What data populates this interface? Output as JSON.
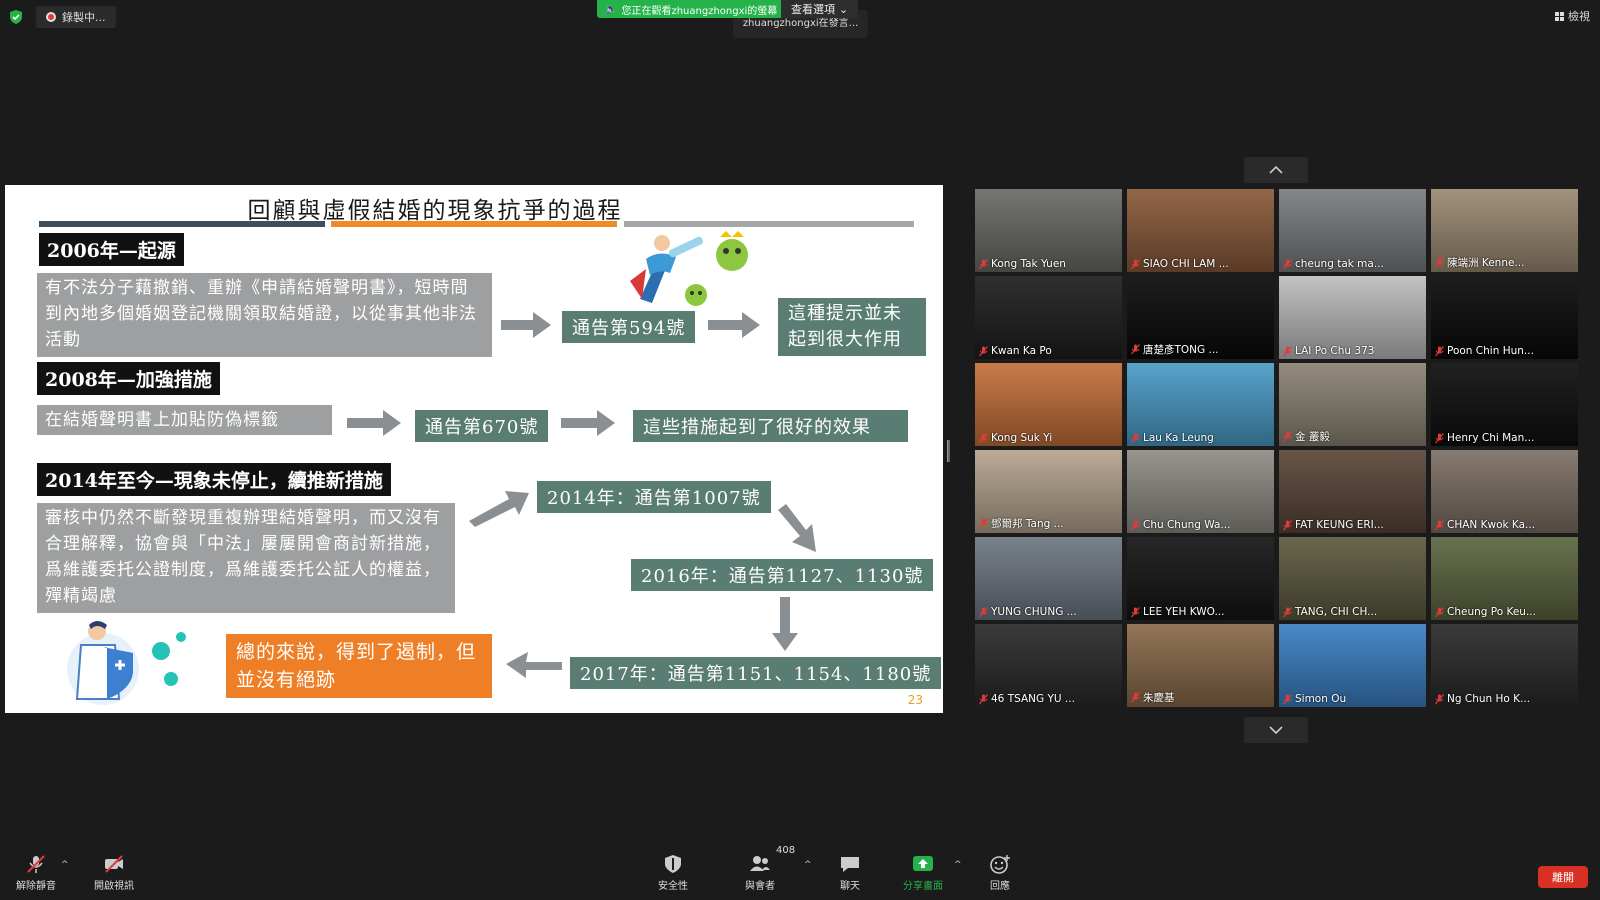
{
  "top": {
    "recording_label": "錄製中...",
    "viewing_banner": "您正在觀看zhuangzhongxi的螢幕",
    "view_options_label": "查看選項",
    "sharer_tip": "zhuangzhongxi在發言...",
    "view_label": "檢視"
  },
  "slide": {
    "title": "回顧與虛假結婚的現象抗爭的過程",
    "page_number": "23",
    "sec1": {
      "header": "2006年—起源",
      "text": "有不法分子藉撤銷、重辦《申請結婚聲明書》，短時間到內地多個婚姻登記機關領取結婚證，以從事其他非法活動",
      "notice": "通告第594號",
      "result": "這種提示並未起到很大作用"
    },
    "sec2": {
      "header": "2008年—加強措施",
      "text": "在結婚聲明書上加貼防偽標籤",
      "notice": "通告第670號",
      "result": "這些措施起到了很好的效果"
    },
    "sec3": {
      "header": "2014年至今—現象未停止，續推新措施",
      "text": "審核中仍然不斷發現重複辦理結婚聲明，而又沒有合理解釋，協會與「中法」屢屢開會商討新措施，爲維護委托公證制度，爲維護委托公証人的權益，殫精竭慮",
      "n2014": "2014年：通告第1007號",
      "n2016": "2016年：通告第1127、1130號",
      "n2017": "2017年：通告第1151、1154、1180號",
      "conclusion": "總的來說，得到了遏制，但並沒有絕跡"
    }
  },
  "participants": [
    {
      "name": "Kong Tak Yuen",
      "bg": "#6b6a66"
    },
    {
      "name": "SIAO CHI LAM ...",
      "bg": "#8a5a3a"
    },
    {
      "name": "cheung tak ma...",
      "bg": "#7a7c7e"
    },
    {
      "name": "陳端洲 Kenne...",
      "bg": "#9b8a72"
    },
    {
      "name": "Kwan Ka Po",
      "bg": "#1e1e1e"
    },
    {
      "name": "唐楚彥TONG ...",
      "bg": "#0a0a0a"
    },
    {
      "name": "LAI Po Chu 373",
      "bg": "#bdbdbd"
    },
    {
      "name": "Poon Chin Hun...",
      "bg": "#0a0a0a"
    },
    {
      "name": "Kong Suk Yi",
      "bg": "#c4703a"
    },
    {
      "name": "Lau Ka Leung",
      "bg": "#4a9cc8"
    },
    {
      "name": "金 叢毅",
      "bg": "#8b8373"
    },
    {
      "name": "Henry Chi Man...",
      "bg": "#0e0e0e"
    },
    {
      "name": "鄧爾邦 Tang ...",
      "bg": "#b6a48e"
    },
    {
      "name": "Chu Chung Wa...",
      "bg": "#8e8c84"
    },
    {
      "name": "FAT KEUNG ERI...",
      "bg": "#5b4638"
    },
    {
      "name": "CHAN Kwok Ka...",
      "bg": "#7d6f64"
    },
    {
      "name": "YUNG CHUNG ...",
      "bg": "#6e7782"
    },
    {
      "name": "LEE YEH KWO...",
      "bg": "#151515"
    },
    {
      "name": "TANG, CHI CH...",
      "bg": "#5c5a3e"
    },
    {
      "name": "Cheung Po Keu...",
      "bg": "#5c6640"
    },
    {
      "name": "46 TSANG YU ...",
      "bg": "#2a2a2a"
    },
    {
      "name": "朱慶基",
      "bg": "#8a6a4a"
    },
    {
      "name": "Simon Ou",
      "bg": "#3b7fc4"
    },
    {
      "name": "Ng Chun Ho K...",
      "bg": "#2a2a2a"
    }
  ],
  "toolbar": {
    "unmute": "解除靜音",
    "start_video": "開啟視訊",
    "security": "安全性",
    "participants": "與會者",
    "participants_count": "408",
    "chat": "聊天",
    "share": "分享畫面",
    "reactions": "回應",
    "leave": "離開"
  },
  "colors": {
    "accent_green": "#25b24a",
    "leave_red": "#d93025",
    "slide_teal": "#5a7d73",
    "slide_orange": "#ef7f26"
  }
}
